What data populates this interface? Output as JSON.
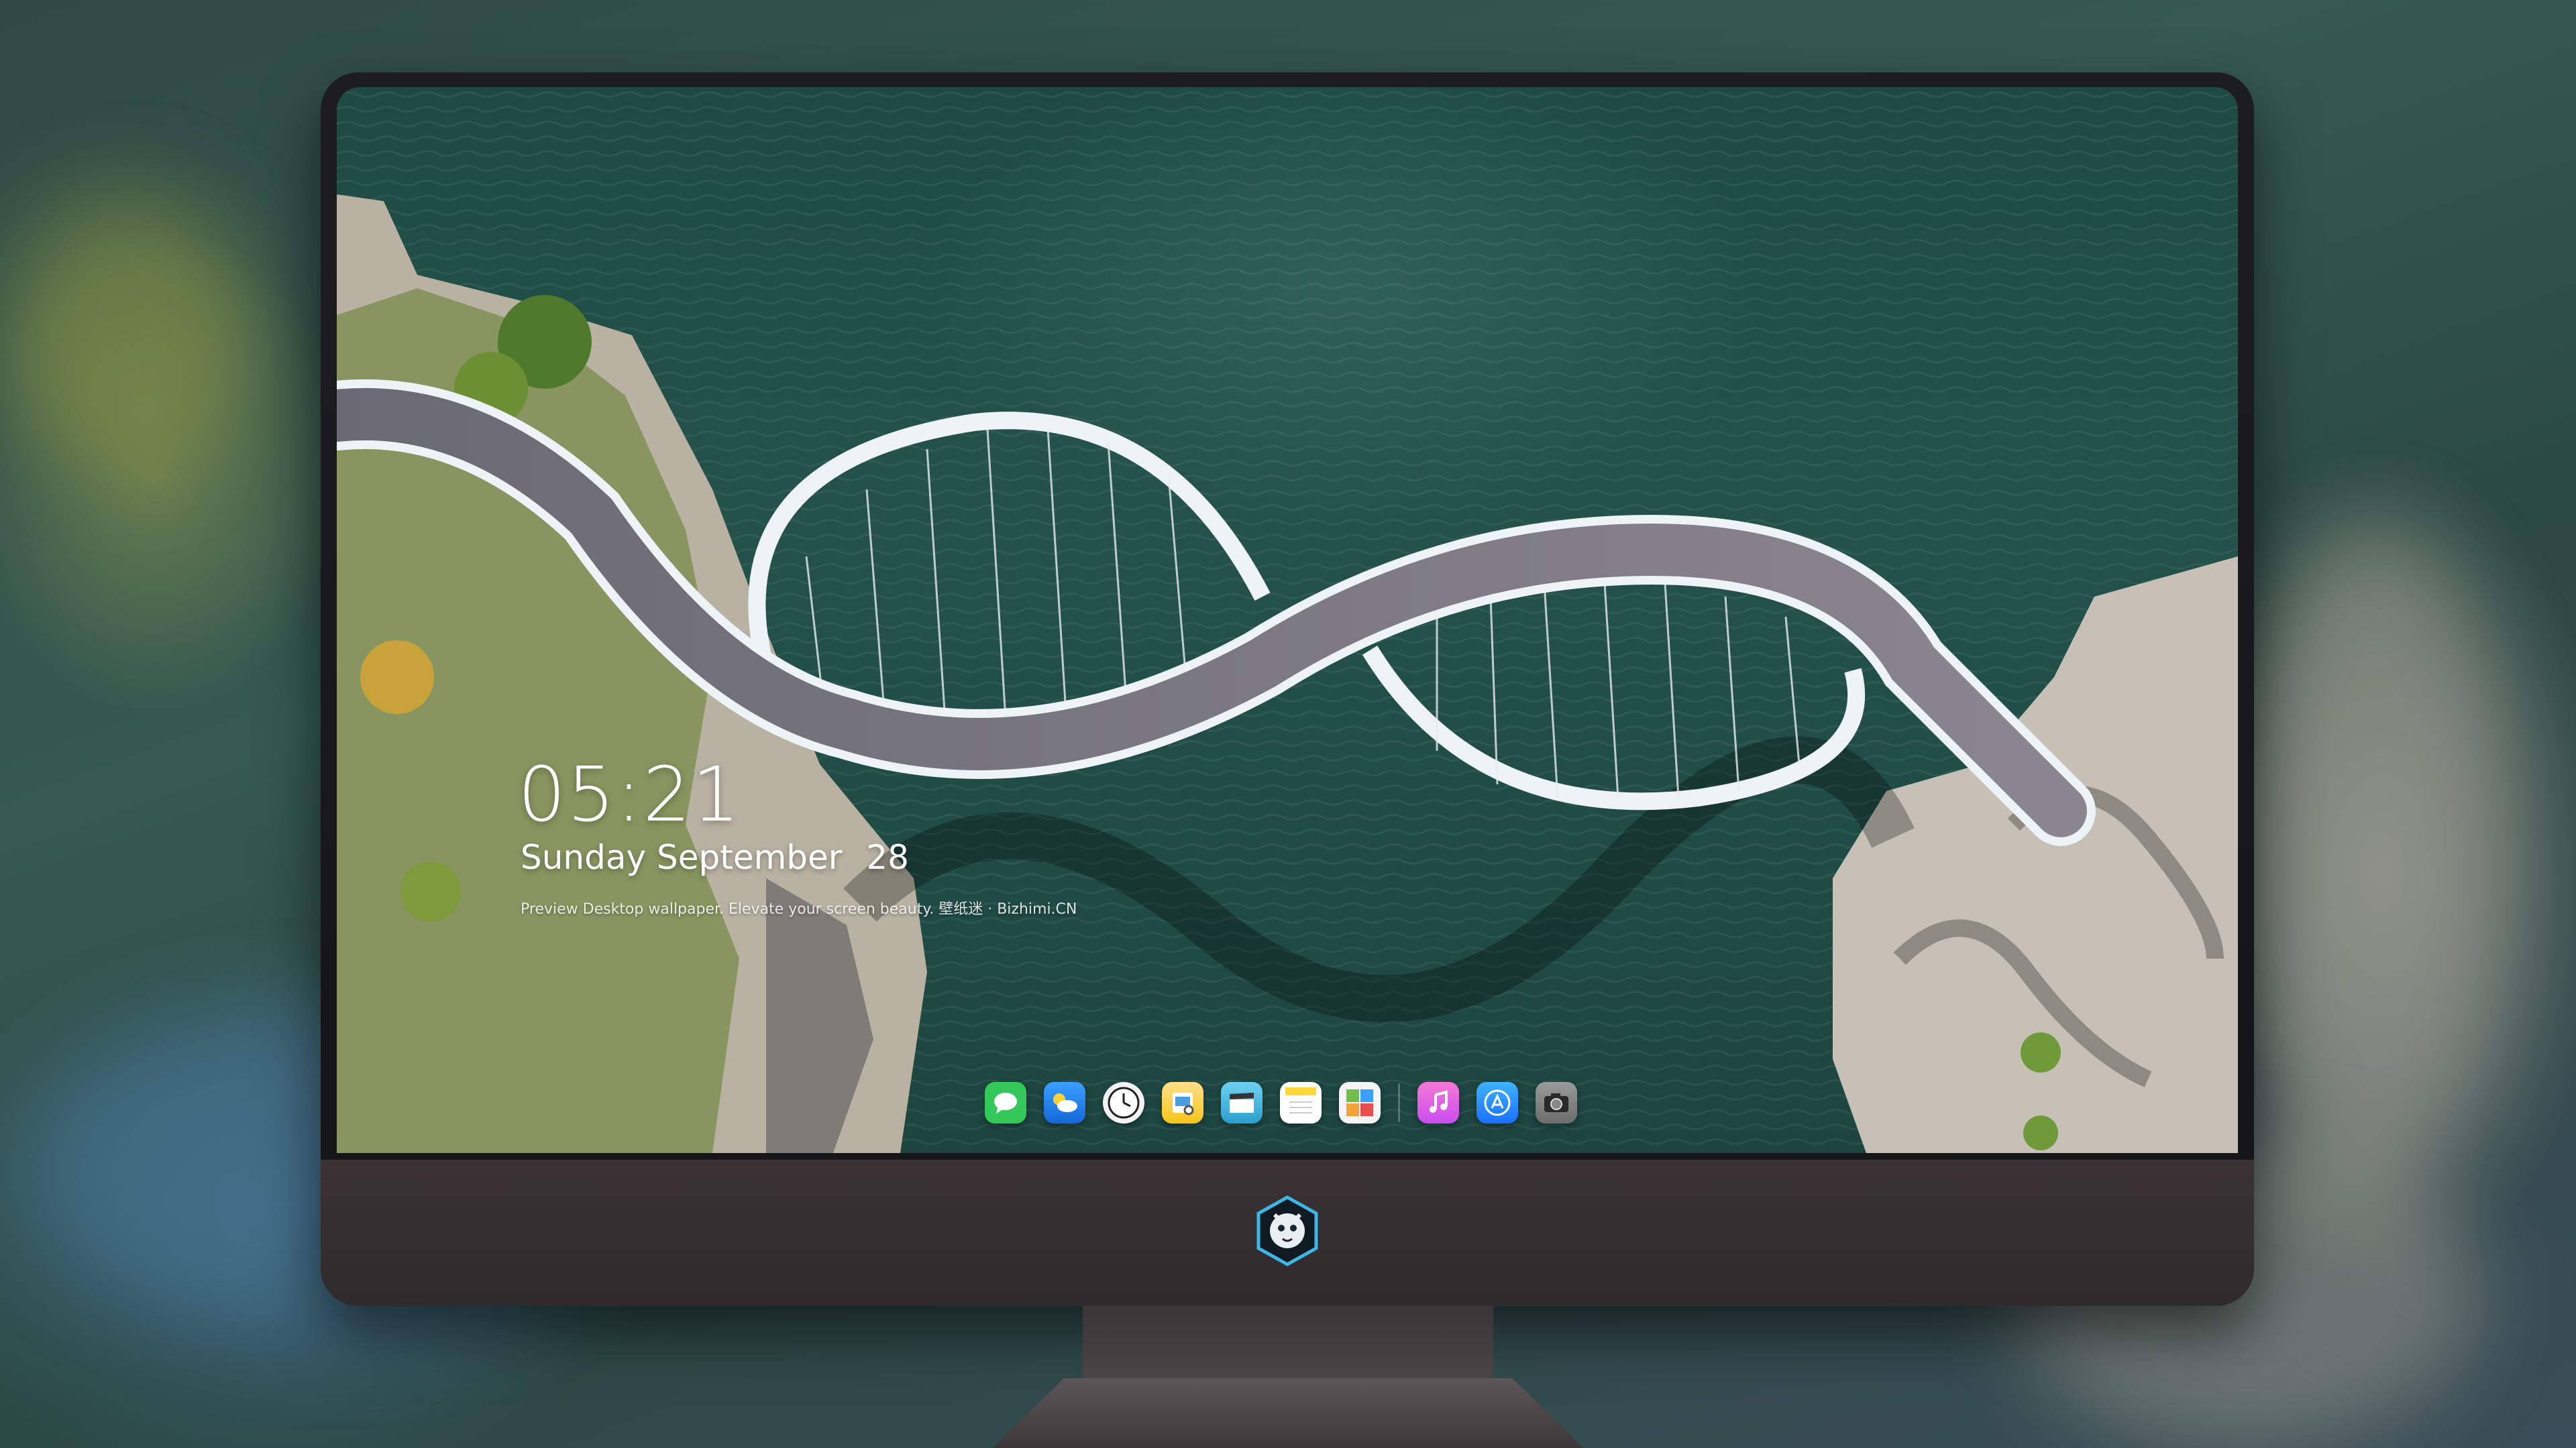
{
  "lock_screen": {
    "time": "05:21",
    "date_weekday_month": "Sunday September",
    "date_day": "28",
    "preview_notice": "Preview Desktop wallpaper. Elevate your screen beauty. 壁纸迷 · Bizhimi.CN"
  },
  "dock": {
    "apps": [
      {
        "name": "Messages",
        "icon": "messages-icon",
        "color": "#34c759"
      },
      {
        "name": "Weather",
        "icon": "weather-icon",
        "color": "#1e90ff"
      },
      {
        "name": "Clock",
        "icon": "clock-icon",
        "color": "#f2f2f2"
      },
      {
        "name": "Preview",
        "icon": "preview-icon",
        "color": "#f5c518"
      },
      {
        "name": "Clips",
        "icon": "clapperboard-icon",
        "color": "#38b6e0"
      },
      {
        "name": "Notes",
        "icon": "notes-icon",
        "color": "#ffd93b"
      },
      {
        "name": "Photo Booth",
        "icon": "photo-booth-icon",
        "color": "#6fbf4a"
      },
      {
        "name": "iTunes",
        "icon": "music-icon",
        "color": "#e94ec0"
      },
      {
        "name": "App Store",
        "icon": "app-store-icon",
        "color": "#1a8cff"
      },
      {
        "name": "Camera",
        "icon": "camera-icon",
        "color": "#8a8a8a"
      }
    ]
  },
  "colors": {
    "water": "#24524b",
    "bridge": "#eef3f8",
    "bezel": "#1a1a1c",
    "chin": "#352e31"
  }
}
